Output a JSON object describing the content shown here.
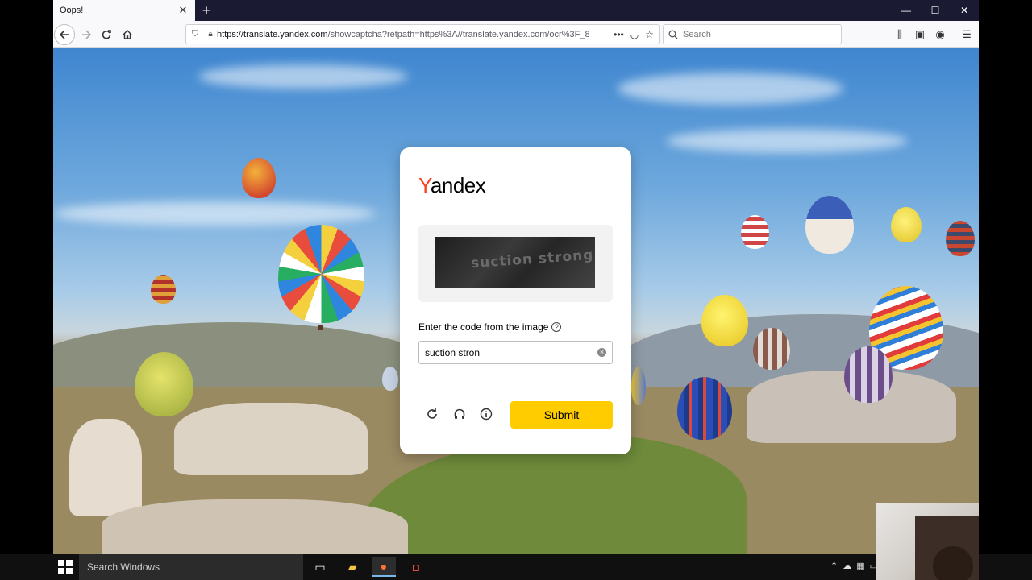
{
  "browser": {
    "tab_title": "Oops!",
    "tab_close": "✕",
    "new_tab": "+",
    "url_host": "https://translate.yandex.com",
    "url_rest": "/showcaptcha?retpath=https%3A//translate.yandex.com/ocr%3F_8",
    "search_placeholder": "Search",
    "window_controls": [
      "—",
      "☐",
      "✕"
    ]
  },
  "captcha": {
    "logo_first": "Y",
    "logo_rest": "andex",
    "captcha_image_text": "suction strong",
    "prompt": "Enter the code from the image",
    "help_glyph": "?",
    "input_value": "suction stron",
    "clear_glyph": "×",
    "submit_label": "Submit"
  },
  "taskbar": {
    "search_placeholder": "Search Windows"
  },
  "colors": {
    "accent": "#ffcc00",
    "logo_red": "#fc3f1d",
    "tabstrip": "#1b1a33"
  }
}
